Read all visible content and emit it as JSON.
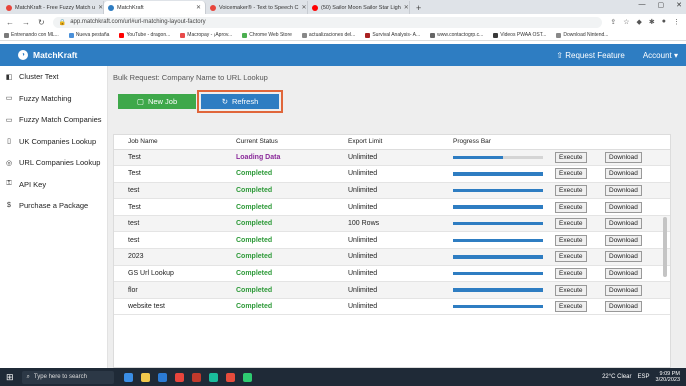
{
  "browser": {
    "tabs": [
      {
        "label": "MatchKraft - Free Fuzzy Match u",
        "color": "#e8453c",
        "active": false
      },
      {
        "label": "MatchKraft",
        "color": "#2e7dc2",
        "active": true
      },
      {
        "label": "Voicemaker® - Text to Speech C",
        "color": "#e8453c",
        "active": false
      },
      {
        "label": "(50) Sailor Moon Sailor Star Ligh",
        "color": "#ff0000",
        "active": false
      }
    ],
    "url": "app.matchkraft.com/url#url-matching-layout-factory",
    "bookmarks": [
      {
        "label": "Entrenando con ML...",
        "color": "#7a7a7a"
      },
      {
        "label": "Nueva pestaña",
        "color": "#4a90d9"
      },
      {
        "label": "YouTube - dragon...",
        "color": "#ff0000"
      },
      {
        "label": "Macropay - ¡Aprov...",
        "color": "#e84a4a"
      },
      {
        "label": "Chrome Web Store",
        "color": "#4caf50"
      },
      {
        "label": "actualizaciones del...",
        "color": "#888888"
      },
      {
        "label": "Survival Analysis- A...",
        "color": "#aa2222"
      },
      {
        "label": "www.contactogrp.c...",
        "color": "#666666"
      },
      {
        "label": "Videos PWAA OST...",
        "color": "#3a3a3a"
      },
      {
        "label": "Download Nintend...",
        "color": "#888888"
      }
    ]
  },
  "app": {
    "brand": "MatchKraft",
    "nav_request": "Request Feature",
    "nav_account": "Account"
  },
  "sidebar": {
    "items": [
      {
        "label": "Cluster Text",
        "icon": "◧"
      },
      {
        "label": "Fuzzy Matching",
        "icon": "▭"
      },
      {
        "label": "Fuzzy Match Companies",
        "icon": "▭"
      },
      {
        "label": "UK Companies Lookup",
        "icon": "▯"
      },
      {
        "label": "URL Companies Lookup",
        "icon": "◎"
      },
      {
        "label": "API Key",
        "icon": "⚿"
      },
      {
        "label": "Purchase a Package",
        "icon": "$"
      }
    ]
  },
  "main": {
    "title": "Bulk Request: Company Name to URL Lookup",
    "new_job_label": "New Job",
    "refresh_label": "Refresh",
    "table": {
      "headers": [
        "Job Name",
        "Current Status",
        "Export Limit",
        "Progress Bar",
        "",
        ""
      ],
      "execute_label": "Execute",
      "download_label": "Download",
      "rows": [
        {
          "name": "Test",
          "status": "Loading Data",
          "limit": "Unlimited",
          "progress": 0.55
        },
        {
          "name": "Test",
          "status": "Completed",
          "limit": "Unlimited",
          "progress": 1
        },
        {
          "name": "test",
          "status": "Completed",
          "limit": "Unlimited",
          "progress": 1
        },
        {
          "name": "Test",
          "status": "Completed",
          "limit": "Unlimited",
          "progress": 1
        },
        {
          "name": "test",
          "status": "Completed",
          "limit": "100 Rows",
          "progress": 1
        },
        {
          "name": "test",
          "status": "Completed",
          "limit": "Unlimited",
          "progress": 1
        },
        {
          "name": "2023",
          "status": "Completed",
          "limit": "Unlimited",
          "progress": 1
        },
        {
          "name": "GS Url Lookup",
          "status": "Completed",
          "limit": "Unlimited",
          "progress": 1
        },
        {
          "name": "flor",
          "status": "Completed",
          "limit": "Unlimited",
          "progress": 1
        },
        {
          "name": "website test",
          "status": "Completed",
          "limit": "Unlimited",
          "progress": 1
        }
      ]
    }
  },
  "taskbar": {
    "search_placeholder": "Type here to search",
    "weather": "22°C  Clear",
    "lang": "ESP",
    "time": "9:09 PM",
    "date": "3/20/2023"
  }
}
